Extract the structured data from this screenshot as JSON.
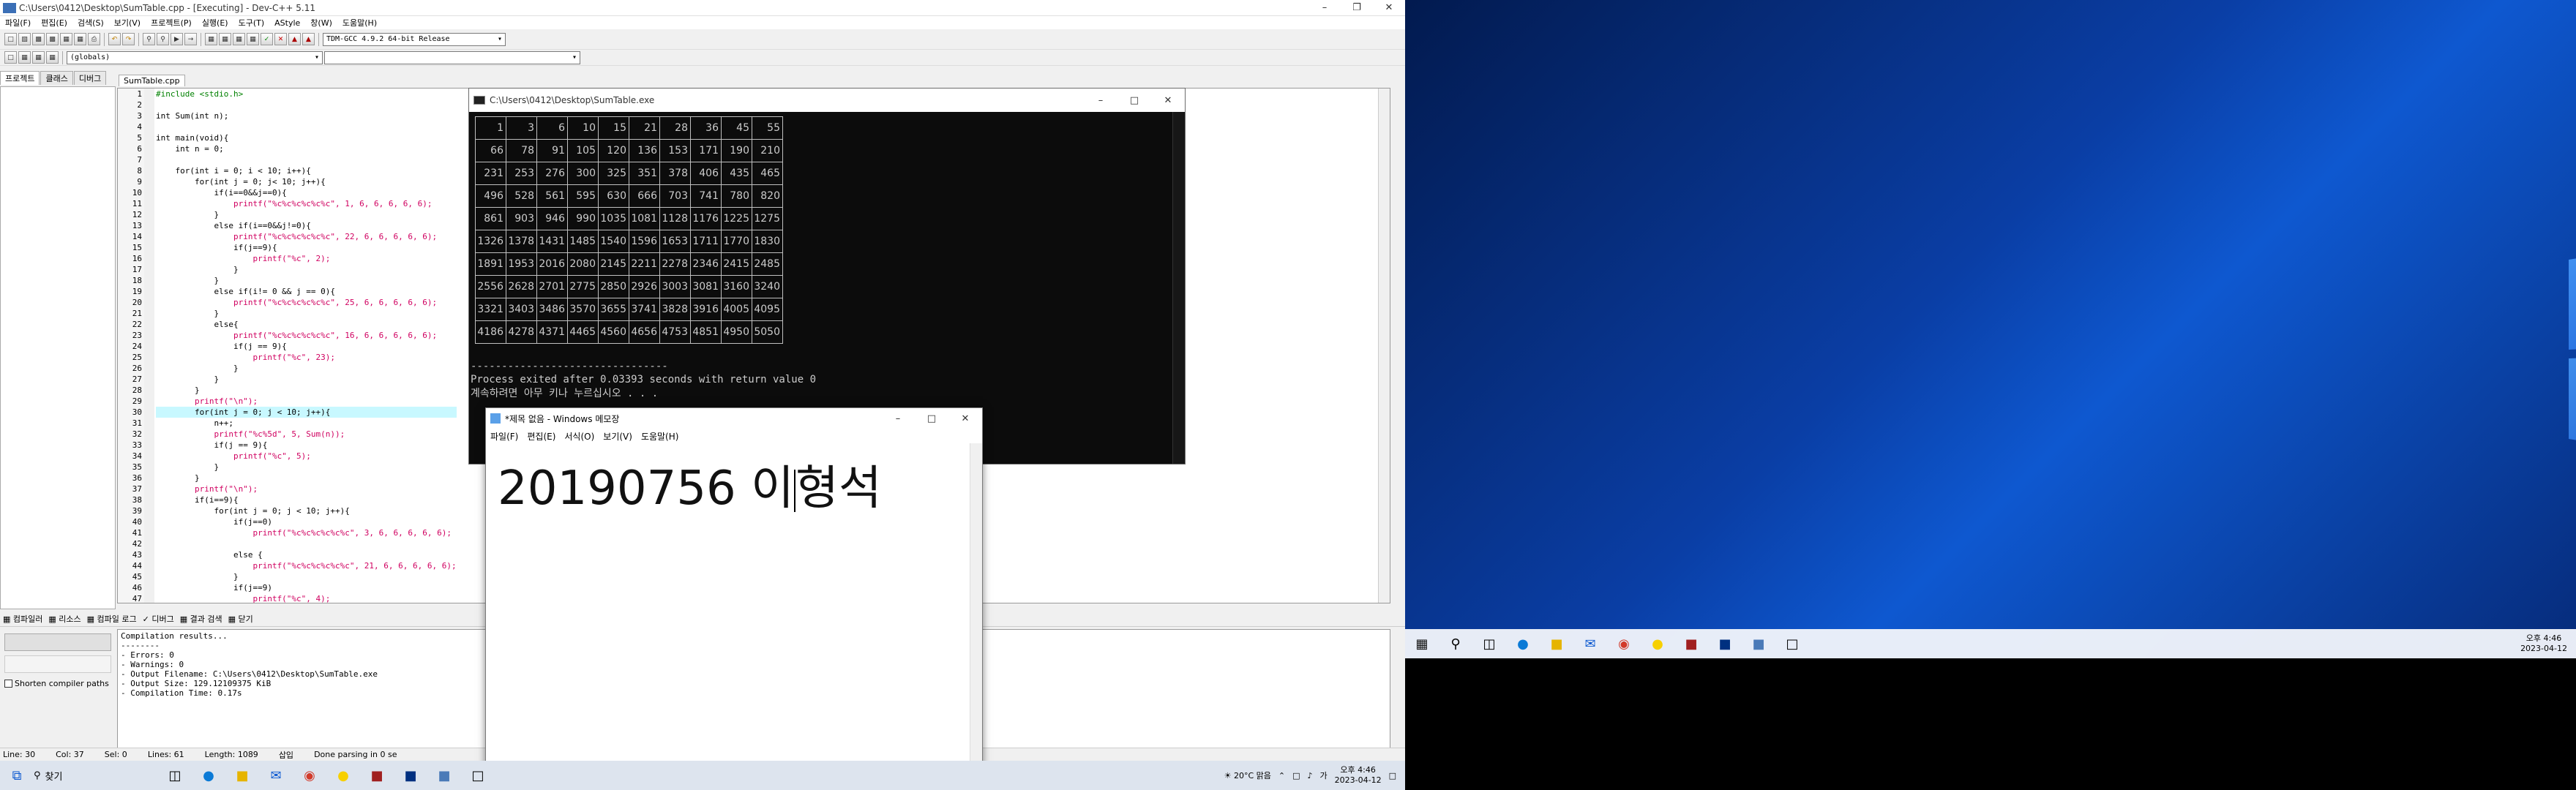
{
  "ide": {
    "title": "C:\\Users\\0412\\Desktop\\SumTable.cpp - [Executing] - Dev-C++ 5.11",
    "menu": [
      "파일(F)",
      "편집(E)",
      "검색(S)",
      "보기(V)",
      "프로젝트(P)",
      "실행(E)",
      "도구(T)",
      "AStyle",
      "창(W)",
      "도움말(H)"
    ],
    "compiler_combo": "TDM-GCC 4.9.2 64-bit Release",
    "globals_combo": "(globals)",
    "left_tabs": [
      "프로젝트",
      "클래스",
      "디버그"
    ],
    "file_tab": "SumTable.cpp",
    "code_lines": [
      "#include <stdio.h>",
      "",
      "int Sum(int n);",
      "",
      "int main(void){",
      "    int n = 0;",
      "",
      "    for(int i = 0; i < 10; i++){",
      "        for(int j = 0; j< 10; j++){",
      "            if(i==0&&j==0){",
      "                printf(\"%c%c%c%c%c%c\", 1, 6, 6, 6, 6, 6);",
      "            }",
      "            else if(i==0&&j!=0){",
      "                printf(\"%c%c%c%c%c%c\", 22, 6, 6, 6, 6, 6);",
      "                if(j==9){",
      "                    printf(\"%c\", 2);",
      "                }",
      "            }",
      "            else if(i!= 0 && j == 0){",
      "                printf(\"%c%c%c%c%c%c\", 25, 6, 6, 6, 6, 6);",
      "            }",
      "            else{",
      "                printf(\"%c%c%c%c%c%c\", 16, 6, 6, 6, 6, 6);",
      "                if(j == 9){",
      "                    printf(\"%c\", 23);",
      "                }",
      "            }",
      "        }",
      "        printf(\"\\n\");",
      "        for(int j = 0; j < 10; j++){",
      "            n++;",
      "            printf(\"%c%5d\", 5, Sum(n));",
      "            if(j == 9){",
      "                printf(\"%c\", 5);",
      "            }",
      "        }",
      "        printf(\"\\n\");",
      "        if(i==9){",
      "            for(int j = 0; j < 10; j++){",
      "                if(j==0)",
      "                    printf(\"%c%c%c%c%c%c\", 3, 6, 6, 6, 6, 6);",
      "",
      "                else {",
      "                    printf(\"%c%c%c%c%c%c\", 21, 6, 6, 6, 6, 6);",
      "                }",
      "                if(j==9)",
      "                    printf(\"%c\", 4);"
    ],
    "bottom_tabs": [
      "컴파일러",
      "리소스",
      "컴파일 로그",
      "디버그",
      "결과 검색",
      "닫기"
    ],
    "abort_label": "",
    "shorten_label": "Shorten compiler paths",
    "compile_log": [
      "Compilation results...",
      "--------",
      "- Errors: 0",
      "- Warnings: 0",
      "- Output Filename: C:\\Users\\0412\\Desktop\\SumTable.exe",
      "- Output Size: 129.12109375 KiB",
      "- Compilation Time: 0.17s"
    ],
    "status": {
      "line": "Line:  30",
      "col": "Col:  37",
      "sel": "Sel:  0",
      "lines": "Lines:  61",
      "length": "Length:  1089",
      "mode": "삽입",
      "parse": "Done parsing in 0 se"
    }
  },
  "console": {
    "title": "C:\\Users\\0412\\Desktop\\SumTable.exe",
    "table": [
      [
        1,
        3,
        6,
        10,
        15,
        21,
        28,
        36,
        45,
        55
      ],
      [
        66,
        78,
        91,
        105,
        120,
        136,
        153,
        171,
        190,
        210
      ],
      [
        231,
        253,
        276,
        300,
        325,
        351,
        378,
        406,
        435,
        465
      ],
      [
        496,
        528,
        561,
        595,
        630,
        666,
        703,
        741,
        780,
        820
      ],
      [
        861,
        903,
        946,
        990,
        1035,
        1081,
        1128,
        1176,
        1225,
        1275
      ],
      [
        1326,
        1378,
        1431,
        1485,
        1540,
        1596,
        1653,
        1711,
        1770,
        1830
      ],
      [
        1891,
        1953,
        2016,
        2080,
        2145,
        2211,
        2278,
        2346,
        2415,
        2485
      ],
      [
        2556,
        2628,
        2701,
        2775,
        2850,
        2926,
        3003,
        3081,
        3160,
        3240
      ],
      [
        3321,
        3403,
        3486,
        3570,
        3655,
        3741,
        3828,
        3916,
        4005,
        4095
      ],
      [
        4186,
        4278,
        4371,
        4465,
        4560,
        4656,
        4753,
        4851,
        4950,
        5050
      ]
    ],
    "divider": "--------------------------------",
    "exit_line": "Process exited after 0.03393 seconds with return value 0",
    "continue_line": "계속하려면 아무 키나 누르십시오 . . ."
  },
  "notepad": {
    "title": "*제목 없음 - Windows 메모장",
    "menu": [
      "파일(F)",
      "편집(E)",
      "서식(O)",
      "보기(V)",
      "도움말(H)"
    ],
    "text_before_cursor": "20190756 이",
    "text_after_cursor": "형석"
  },
  "taskbar": {
    "search_placeholder": "찾기",
    "weather": "20°C 맑음",
    "time": "오후 4:46",
    "date": "2023-04-12",
    "lang": "가"
  },
  "taskbar2": {
    "time": "오후 4:46",
    "date": "2023-04-12"
  }
}
